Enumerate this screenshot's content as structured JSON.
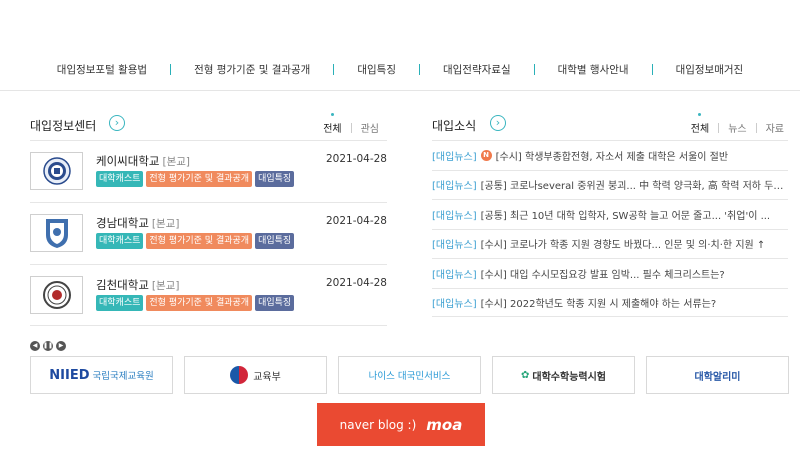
{
  "nav": {
    "items": [
      "대입정보포털 활용법",
      "전형 평가기준 및 결과공개",
      "대입특징",
      "대입전략자료실",
      "대학별 행사안내",
      "대입정보매거진"
    ]
  },
  "center": {
    "title": "대입정보센터",
    "tabs": [
      "전체",
      "관심"
    ],
    "universities": [
      {
        "name": "케이씨대학교",
        "branch": "[본교]",
        "date": "2021-04-28",
        "tags": [
          "대학캐스트",
          "전형 평가기준 및 결과공개",
          "대입특징"
        ]
      },
      {
        "name": "경남대학교",
        "branch": "[본교]",
        "date": "2021-04-28",
        "tags": [
          "대학캐스트",
          "전형 평가기준 및 결과공개",
          "대입특징"
        ]
      },
      {
        "name": "김천대학교",
        "branch": "[본교]",
        "date": "2021-04-28",
        "tags": [
          "대학캐스트",
          "전형 평가기준 및 결과공개",
          "대입특징"
        ]
      }
    ]
  },
  "news": {
    "title": "대입소식",
    "tabs": [
      "전체",
      "뉴스",
      "자료"
    ],
    "new_badge": "N",
    "items": [
      {
        "category": "[대입뉴스]",
        "title": "[수시] 학생부종합전형, 자소서 제출 대학은 서울이 절반",
        "is_new": true
      },
      {
        "category": "[대입뉴스]",
        "title": "[공통] 코로나several 중위권 붕괴... 中 학력 양극화, 高 학력 저하 두드...",
        "is_new": false
      },
      {
        "category": "[대입뉴스]",
        "title": "[공통] 최근 10년 대학 입학자, SW공학 늘고 어문 줄고... '취업'이 ...",
        "is_new": false
      },
      {
        "category": "[대입뉴스]",
        "title": "[수시] 코로나가 학종 지원 경향도 바꿨다... 인문 및 의·치·한 지원 ↑",
        "is_new": false
      },
      {
        "category": "[대입뉴스]",
        "title": "[수시] 대입 수시모집요강 발표 임박... 필수 체크리스트는?",
        "is_new": false
      },
      {
        "category": "[대입뉴스]",
        "title": "[수시] 2022학년도 학종 지원 시 제출해야 하는 서류는?",
        "is_new": false
      }
    ]
  },
  "banners": {
    "niied_logo": "NIIED",
    "niied_text": "국립국제교육원",
    "moe": "교육부",
    "neis": "나이스 대국민서비스",
    "kice": "대학수학능력시험",
    "alrimi": "대학알리미"
  },
  "blog": {
    "label": "naver blog :)",
    "name": "moa"
  },
  "colors": {
    "accent": "#3bb6c0",
    "tag_teal": "#35b7b7",
    "tag_orange": "#f08a5d",
    "tag_navy": "#5b6c9d",
    "news_category": "#3a9fd1",
    "blog_badge": "#ea4a32"
  }
}
